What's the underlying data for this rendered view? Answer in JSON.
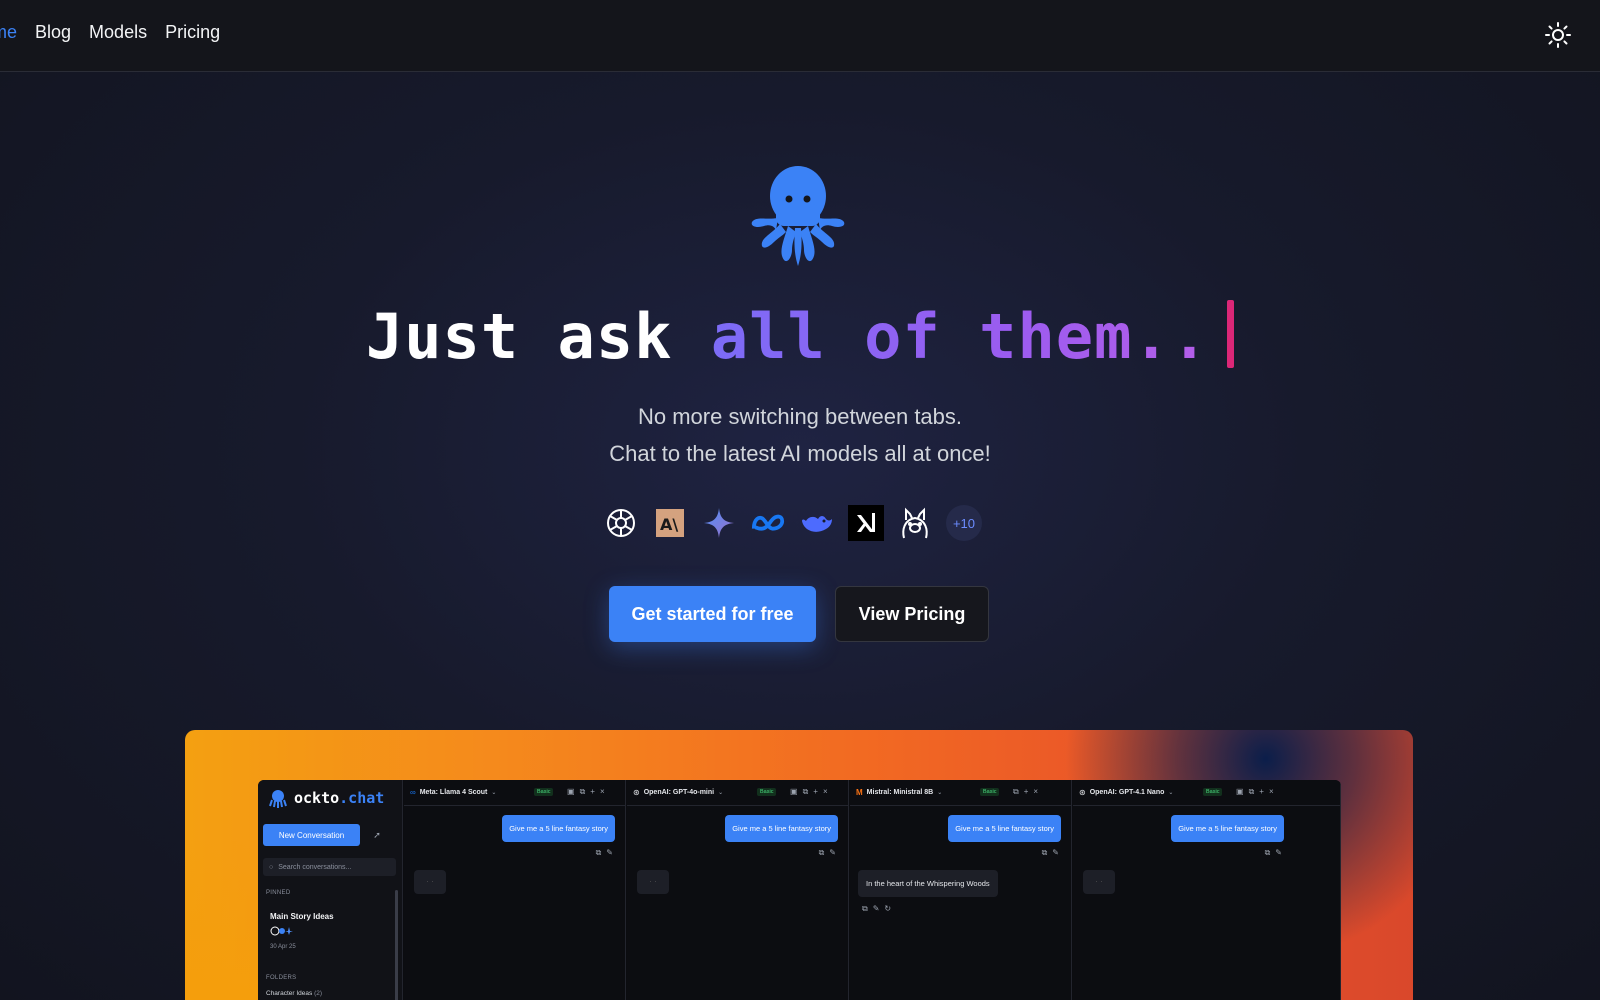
{
  "nav": {
    "links": [
      {
        "label": "Home"
      },
      {
        "label": "Blog"
      },
      {
        "label": "Models"
      },
      {
        "label": "Pricing"
      }
    ],
    "active_partial": "me"
  },
  "hero": {
    "headline_plain": "Just ask ",
    "headline_accent": "all of them..",
    "sub1": "No more switching between tabs.",
    "sub2": "Chat to the latest AI models all at once!",
    "providers": [
      "openai-icon",
      "anthropic-icon",
      "gemini-icon",
      "meta-icon",
      "deepseek-icon",
      "xai-icon",
      "ollama-icon"
    ],
    "more_count": "+10",
    "cta_primary": "Get started for free",
    "cta_secondary": "View Pricing"
  },
  "colors": {
    "accent": "#3b82f6",
    "gradient_start": "#7c6cf6",
    "gradient_end": "#b45ee8",
    "cursor": "#db2777"
  },
  "preview": {
    "logo_a": "ockto",
    "logo_b": ".chat",
    "new_conversation": "New Conversation",
    "search_placeholder": "Search conversations...",
    "pinned_label": "PINNED",
    "pinned_title": "Main Story Ideas",
    "pinned_date": "30 Apr 25",
    "folders_label": "FOLDERS",
    "folder_item": "Character Ideas",
    "folder_count": "(2)",
    "badge": "Basic",
    "panels": [
      {
        "model": "Meta: Llama 4 Scout",
        "user_msg": "Give me a 5 line fantasy story",
        "reply": ""
      },
      {
        "model": "OpenAI: GPT-4o-mini",
        "user_msg": "Give me a 5 line fantasy story",
        "reply": ""
      },
      {
        "model": "Mistral: Ministral 8B",
        "user_msg": "Give me a 5 line fantasy story",
        "reply": "In the heart of the Whispering Woods"
      },
      {
        "model": "OpenAI: GPT-4.1 Nano",
        "user_msg": "Give me a 5 line fantasy story",
        "reply": ""
      }
    ]
  }
}
